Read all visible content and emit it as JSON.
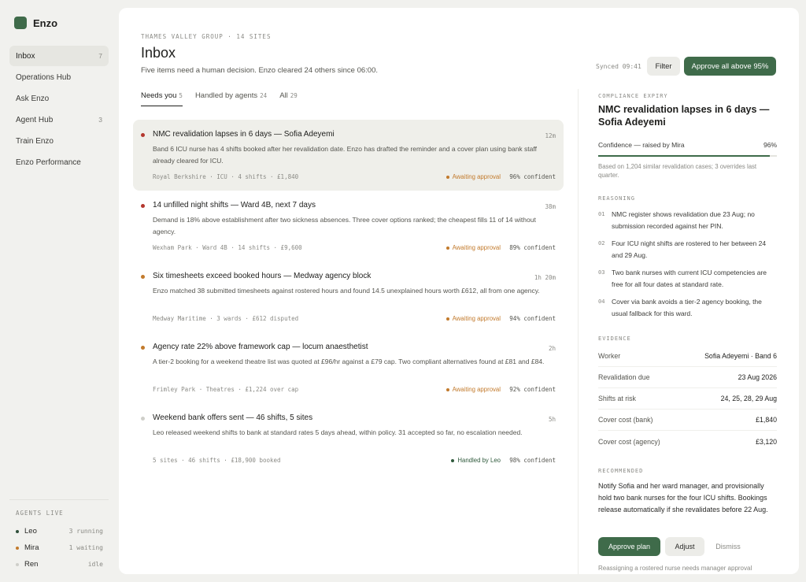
{
  "app": {
    "name": "Enzo"
  },
  "sidebar": {
    "items": [
      {
        "label": "Inbox",
        "count": "7"
      },
      {
        "label": "Operations Hub",
        "count": ""
      },
      {
        "label": "Ask Enzo",
        "count": ""
      },
      {
        "label": "Agent Hub",
        "count": "3"
      },
      {
        "label": "Train Enzo",
        "count": ""
      },
      {
        "label": "Enzo Performance",
        "count": ""
      }
    ],
    "agents_label": "AGENTS LIVE",
    "agents": [
      {
        "name": "Leo",
        "status": "3 running",
        "color": "#2f4f3a"
      },
      {
        "name": "Mira",
        "status": "1 waiting",
        "color": "#c27a2c"
      },
      {
        "name": "Ren",
        "status": "idle",
        "color": "#cfcfca"
      }
    ]
  },
  "header": {
    "eyebrow": "THAMES VALLEY GROUP · 14 SITES",
    "title": "Inbox",
    "subtitle": "Five items need a human decision. Enzo cleared 24 others since 06:00.",
    "synced": "Synced 09:41",
    "filter_label": "Filter",
    "approve_all_label": "Approve all above 95%"
  },
  "tabs": [
    {
      "label": "Needs you",
      "count": "5"
    },
    {
      "label": "Handled by agents",
      "count": "24"
    },
    {
      "label": "All",
      "count": "29"
    }
  ],
  "items": [
    {
      "title": "NMC revalidation lapses in 6 days — Sofia Adeyemi",
      "time": "12m",
      "body": "Band 6 ICU nurse has 4 shifts booked after her revalidation date. Enzo has drafted the reminder and a cover plan using bank staff already cleared for ICU.",
      "meta": "Royal Berkshire · ICU · 4 shifts · £1,840",
      "status": "Awaiting approval",
      "confidence": "96% confident",
      "dot_color": "#b4372e",
      "status_color": "#c27a2c"
    },
    {
      "title": "14 unfilled night shifts — Ward 4B, next 7 days",
      "time": "38m",
      "body": "Demand is 18% above establishment after two sickness absences. Three cover options ranked; the cheapest fills 11 of 14 without agency.",
      "meta": "Wexham Park · Ward 4B · 14 shifts · £9,600",
      "status": "Awaiting approval",
      "confidence": "89% confident",
      "dot_color": "#b4372e",
      "status_color": "#c27a2c"
    },
    {
      "title": "Six timesheets exceed booked hours — Medway agency block",
      "time": "1h 20m",
      "body": "Enzo matched 38 submitted timesheets against rostered hours and found 14.5 unexplained hours worth £612, all from one agency.",
      "meta": "Medway Maritime · 3 wards · £612 disputed",
      "status": "Awaiting approval",
      "confidence": "94% confident",
      "dot_color": "#c27a2c",
      "status_color": "#c27a2c"
    },
    {
      "title": "Agency rate 22% above framework cap — locum anaesthetist",
      "time": "2h",
      "body": "A tier-2 booking for a weekend theatre list was quoted at £96/hr against a £79 cap. Two compliant alternatives found at £81 and £84.",
      "meta": "Frimley Park · Theatres · £1,224 over cap",
      "status": "Awaiting approval",
      "confidence": "92% confident",
      "dot_color": "#c27a2c",
      "status_color": "#c27a2c"
    },
    {
      "title": "Weekend bank offers sent — 46 shifts, 5 sites",
      "time": "5h",
      "body": "Leo released weekend shifts to bank at standard rates 5 days ahead, within policy. 31 accepted so far, no escalation needed.",
      "meta": "5 sites · 46 shifts · £18,900 booked",
      "status": "Handled by Leo",
      "confidence": "98% confident",
      "dot_color": "#cfcfca",
      "status_color": "#2f5a3c"
    }
  ],
  "detail": {
    "category": "COMPLIANCE EXPIRY",
    "title": "NMC revalidation lapses in 6 days — Sofia Adeyemi",
    "confidence_label": "Confidence — raised by Mira",
    "confidence_value": "96%",
    "confidence_fraction": 0.96,
    "confidence_note": "Based on 1,204 similar revalidation cases; 3 overrides last quarter.",
    "reasoning_label": "REASONING",
    "reasoning": [
      {
        "num": "01",
        "text": "NMC register shows revalidation due 23 Aug; no submission recorded against her PIN."
      },
      {
        "num": "02",
        "text": "Four ICU night shifts are rostered to her between 24 and 29 Aug."
      },
      {
        "num": "03",
        "text": "Two bank nurses with current ICU competencies are free for all four dates at standard rate."
      },
      {
        "num": "04",
        "text": "Cover via bank avoids a tier-2 agency booking, the usual fallback for this ward."
      }
    ],
    "evidence_label": "EVIDENCE",
    "evidence": [
      {
        "key": "Worker",
        "value": "Sofia Adeyemi · Band 6"
      },
      {
        "key": "Revalidation due",
        "value": "23 Aug 2026"
      },
      {
        "key": "Shifts at risk",
        "value": "24, 25, 28, 29 Aug"
      },
      {
        "key": "Cover cost (bank)",
        "value": "£1,840"
      },
      {
        "key": "Cover cost (agency)",
        "value": "£3,120"
      }
    ],
    "recommended_label": "RECOMMENDED",
    "recommended_text": "Notify Sofia and her ward manager, and provisionally hold two bank nurses for the four ICU shifts. Bookings release automatically if she revalidates before 22 Aug.",
    "approve_label": "Approve plan",
    "adjust_label": "Adjust",
    "dismiss_label": "Dismiss",
    "footnote": "Reassigning a rostered nurse needs manager approval"
  },
  "colors": {
    "accent": "#3f6b4a",
    "urgent": "#b4372e",
    "warning": "#c27a2c"
  }
}
